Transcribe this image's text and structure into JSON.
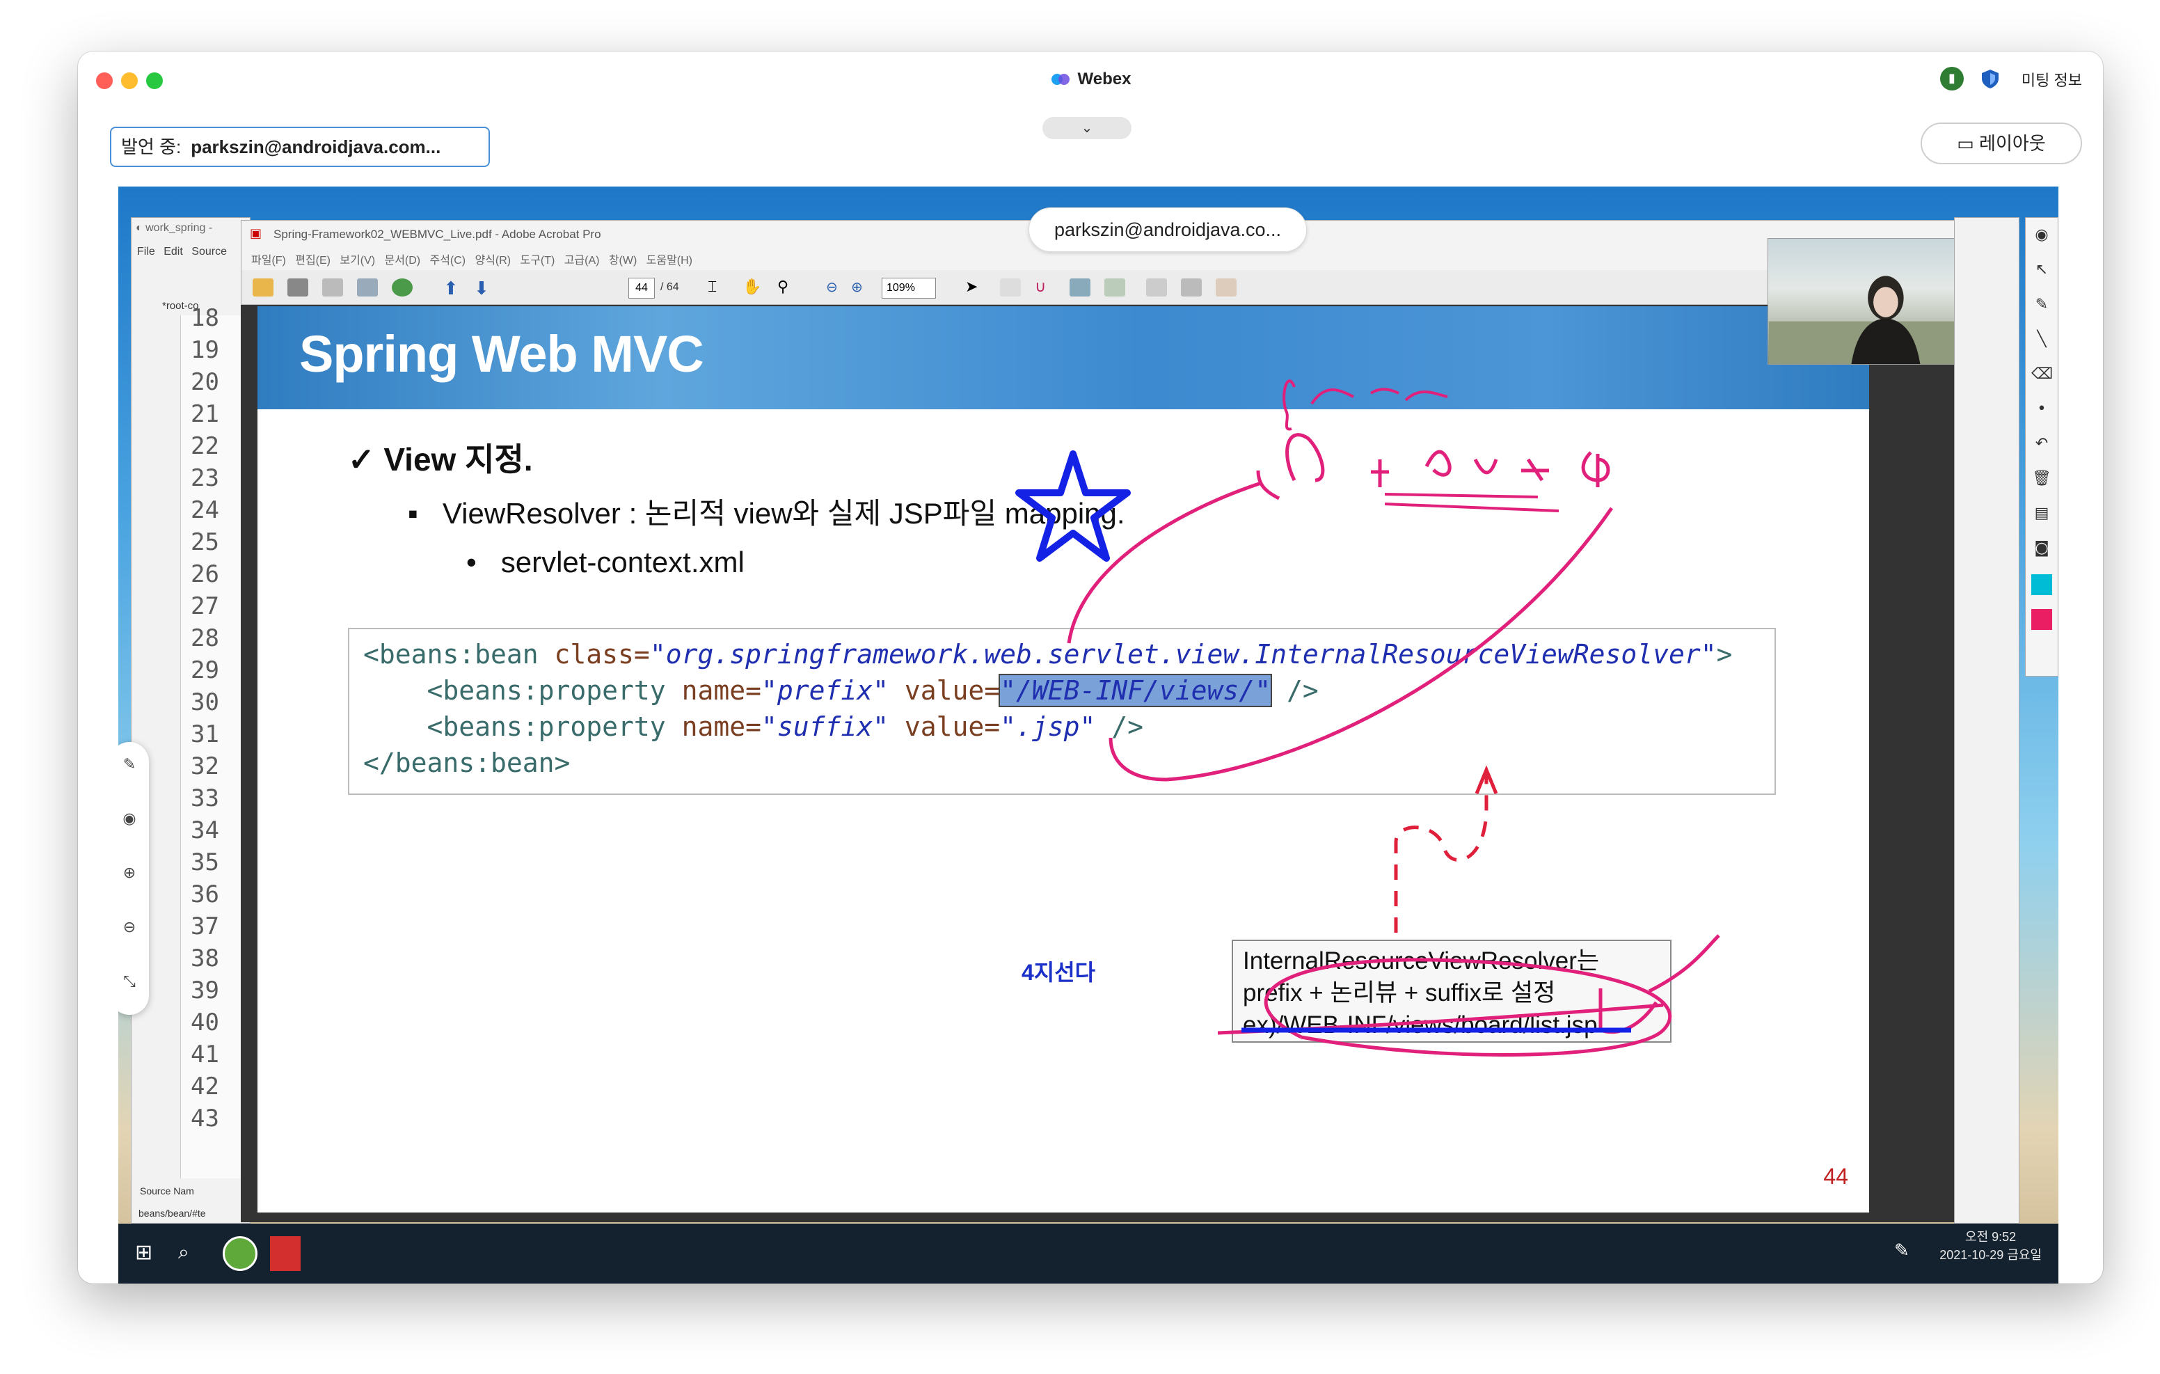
{
  "window": {
    "title": "Webex",
    "meeting_info_label": "미팅 정보",
    "speaker_prefix": "발언 중:",
    "speaker_name": "parkszin@androidjava.com...",
    "layout_label": "레이아웃",
    "signal_icon": "signal-icon",
    "shield_icon": "shield-icon",
    "colors": {
      "close": "#ff5f57",
      "minimize": "#febc2e",
      "zoom": "#28c840",
      "accent": "#4a90d9"
    }
  },
  "share": {
    "presenter_pill": "parkszin@androidjava.co...",
    "eclipse": {
      "title": "work_spring -",
      "menu": [
        "File",
        "Edit",
        "Source"
      ],
      "tab": "*root-co",
      "line_numbers": [
        "18",
        "19",
        "20",
        "21",
        "22",
        "23",
        "24",
        "25",
        "26",
        "27",
        "28",
        "29",
        "30",
        "31",
        "32",
        "33",
        "34",
        "35",
        "36",
        "37",
        "38",
        "39",
        "40",
        "41",
        "42",
        "43"
      ],
      "bottom_tabs": [
        "Source",
        "Nam"
      ],
      "breadcrumb": "beans/bean/#te"
    },
    "acrobat": {
      "title": "Spring-Framework02_WEBMVC_Live.pdf - Adobe Acrobat Pro",
      "menu": [
        "파일(F)",
        "편집(E)",
        "보기(V)",
        "문서(D)",
        "주석(C)",
        "양식(R)",
        "도구(T)",
        "고급(A)",
        "창(W)",
        "도움말(H)"
      ],
      "page_current": "44",
      "page_total": "/ 64",
      "zoom": "109%"
    },
    "slide": {
      "banner_title": "Spring Web MVC",
      "heading": "View 지정.",
      "bullet1": "ViewResolver : 논리적 view와 실제 JSP파일 mapping.",
      "bullet2": "servlet-context.xml",
      "code": {
        "l1_tag": "<beans:bean ",
        "l1_attr": "class=",
        "l1_val": "\"org.springframework.web.servlet.view.InternalResourceViewResolver\"",
        "l1_end": ">",
        "l2_tag": "    <beans:property ",
        "l2_attr1": "name=",
        "l2_val1": "\"prefix\"",
        "l2_attr2": " value=",
        "l2_val2": "\"/WEB-INF/views/\"",
        "l2_end": " />",
        "l3_tag": "    <beans:property ",
        "l3_attr1": "name=",
        "l3_val1": "\"suffix\"",
        "l3_attr2": " value=",
        "l3_val2": "\".jsp\"",
        "l3_end": " />",
        "l4": "</beans:bean>"
      },
      "note_lines": [
        "InternalResourceViewResolver는",
        "prefix + 논리뷰 + suffix로 설정",
        "ex)/WEB-INF/views/board/list.jsp"
      ],
      "annotation_text": "4지선다",
      "page_number": "44"
    },
    "taskbar": {
      "clock_time": "오전 9:52",
      "clock_date": "2021-10-29 금요일"
    }
  }
}
